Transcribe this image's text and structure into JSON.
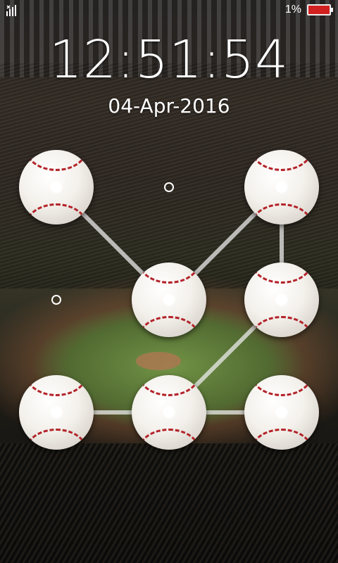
{
  "status_bar": {
    "signal_icon": "signal-icon",
    "battery_percent": "1%",
    "battery_icon": "battery-icon",
    "battery_color": "#d02020"
  },
  "lock_screen": {
    "time": "12:51:54",
    "date": "04-Apr-2016"
  },
  "pattern_lock": {
    "node_style": "baseball",
    "selected_nodes": [
      "row1-col1",
      "row2-col2",
      "row1-col3",
      "row2-col3",
      "row3-col2",
      "row3-col1",
      "row3-col3"
    ],
    "unselected_nodes": [
      "row1-col2",
      "row2-col1"
    ]
  }
}
